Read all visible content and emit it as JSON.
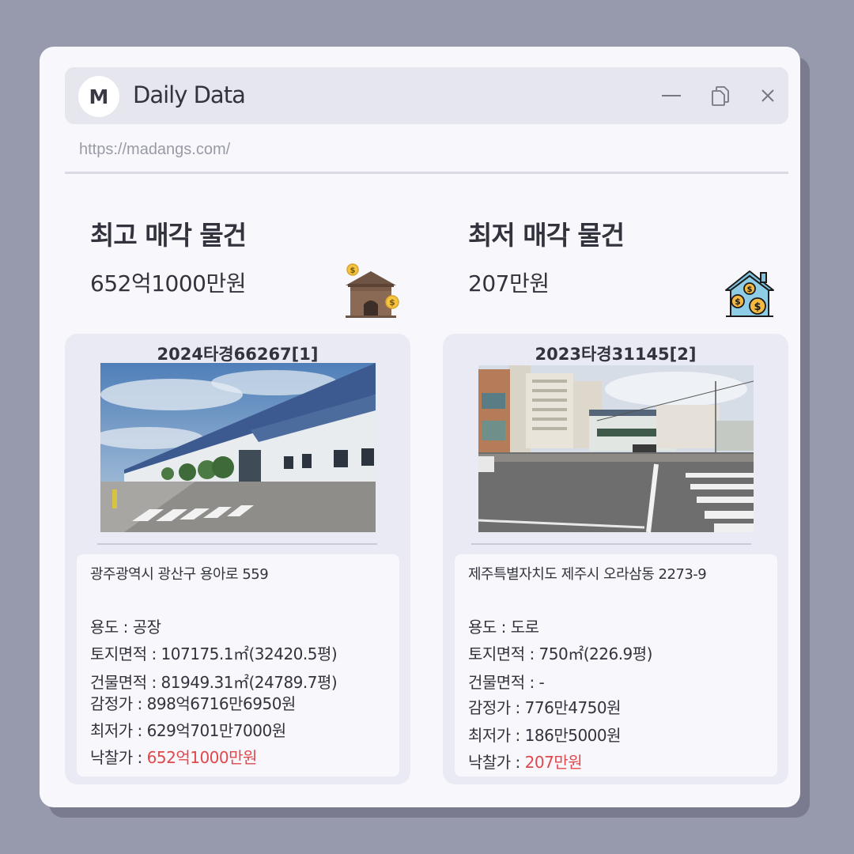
{
  "window": {
    "logo_letter": "M",
    "title": "Daily Data",
    "url": "https://madangs.com/"
  },
  "highest": {
    "title": "최고 매각 물건",
    "value": "652억1000만원",
    "case_id": "2024타경66267[1]",
    "address": "광주광역시 광산구 용아로 559",
    "usage": "용도 : 공장",
    "land_area": "토지면적 : 107175.1㎡(32420.5평)",
    "building_area": "건물면적 : 81949.31㎡(24789.7평)",
    "appraised": "감정가 : 898억6716만6950원",
    "minimum": "최저가 : 629억701만7000원",
    "winning_label": "낙찰가 : ",
    "winning_value": "652억1000만원",
    "icon": "house-money-icon"
  },
  "lowest": {
    "title": "최저 매각 물건",
    "value": "207만원",
    "case_id": "2023타경31145[2]",
    "address": "제주특별자치도 제주시 오라삼동 2273-9",
    "usage": "용도 : 도로",
    "land_area": "토지면적 : 750㎡(226.9평)",
    "building_area": "건물면적 : -",
    "appraised": "감정가 : 776만4750원",
    "minimum": "최저가 : 186만5000원",
    "winning_label": "낙찰가 : ",
    "winning_value": "207만원",
    "icon": "house-coins-icon"
  },
  "colors": {
    "background": "#9799ad",
    "window": "#f7f7fc",
    "card": "#e9eaf3",
    "highlight": "#e0484b"
  }
}
